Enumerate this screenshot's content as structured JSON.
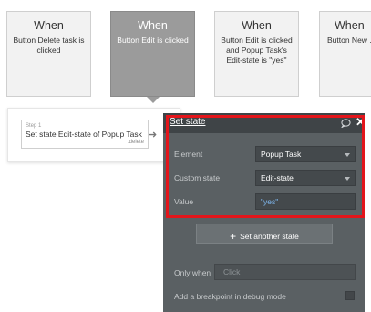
{
  "events": [
    {
      "when": "When",
      "desc": "Button Delete task is clicked"
    },
    {
      "when": "When",
      "desc": "Button Edit is clicked"
    },
    {
      "when": "When",
      "desc": "Button Edit is clicked and Popup Task's Edit-state is \"yes\""
    },
    {
      "when": "When",
      "desc": "Button New ... clicked"
    }
  ],
  "selected_event_index": 1,
  "step": {
    "number_label": "Step 1",
    "title": "Set state Edit-state of Popup Task",
    "sub": ".delete"
  },
  "panel": {
    "title": "Set state",
    "element_label": "Element",
    "element_value": "Popup Task",
    "custom_state_label": "Custom state",
    "custom_state_value": "Edit-state",
    "value_label": "Value",
    "value_value": "\"yes\"",
    "set_another_label": "Set another state",
    "only_when_label": "Only when",
    "only_when_placeholder": "Click",
    "breakpoint_label": "Add a breakpoint in debug mode"
  },
  "colors": {
    "highlight": "#e3151b",
    "panel_bg": "#5a6063",
    "value_text": "#7fb8f0"
  }
}
